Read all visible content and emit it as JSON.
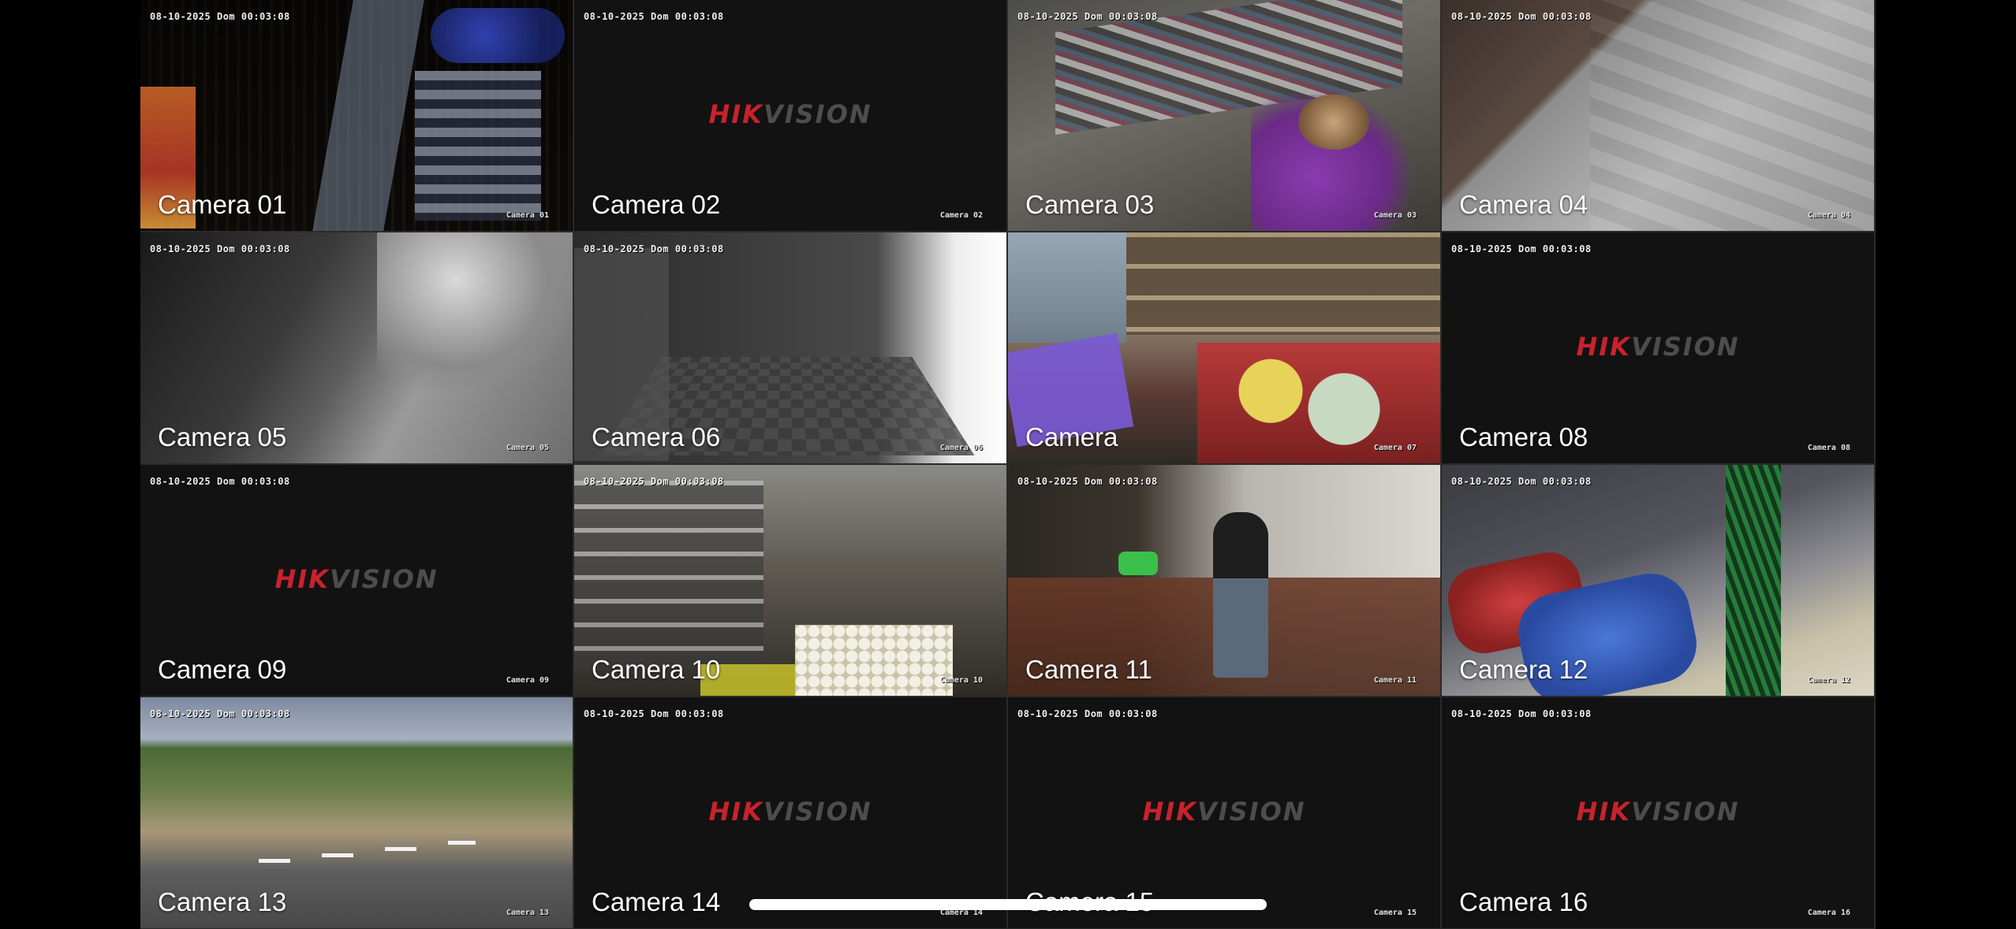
{
  "timestamp": "08-10-2025 Dom 00:03:08",
  "brand": {
    "hik": "HIK",
    "vision": "VISION"
  },
  "selected_camera": "Camera 01",
  "colors": {
    "selection_border": "#e0394a",
    "logo_red": "#c8222d",
    "logo_gray": "#4d4d4d"
  },
  "cameras": [
    {
      "label": "Camera 01",
      "osd": "Camera 01",
      "signal": true
    },
    {
      "label": "Camera 02",
      "osd": "Camera 02",
      "signal": false
    },
    {
      "label": "Camera 03",
      "osd": "Camera 03",
      "signal": true
    },
    {
      "label": "Camera 04",
      "osd": "Camera 04",
      "signal": true
    },
    {
      "label": "Camera 05",
      "osd": "Camera 05",
      "signal": true
    },
    {
      "label": "Camera 06",
      "osd": "Camera 06",
      "signal": true
    },
    {
      "label": "Camera",
      "osd": "Camera 07",
      "signal": true
    },
    {
      "label": "Camera 08",
      "osd": "Camera 08",
      "signal": false
    },
    {
      "label": "Camera 09",
      "osd": "Camera 09",
      "signal": false
    },
    {
      "label": "Camera 10",
      "osd": "Camera 10",
      "signal": true
    },
    {
      "label": "Camera 11",
      "osd": "Camera 11",
      "signal": true
    },
    {
      "label": "Camera 12",
      "osd": "Camera 12",
      "signal": true
    },
    {
      "label": "Camera 13",
      "osd": "Camera 13",
      "signal": true
    },
    {
      "label": "Camera 14",
      "osd": "Camera 14",
      "signal": false
    },
    {
      "label": "Camera 15",
      "osd": "Camera 15",
      "signal": false
    },
    {
      "label": "Camera 16",
      "osd": "Camera 16",
      "signal": false
    }
  ]
}
